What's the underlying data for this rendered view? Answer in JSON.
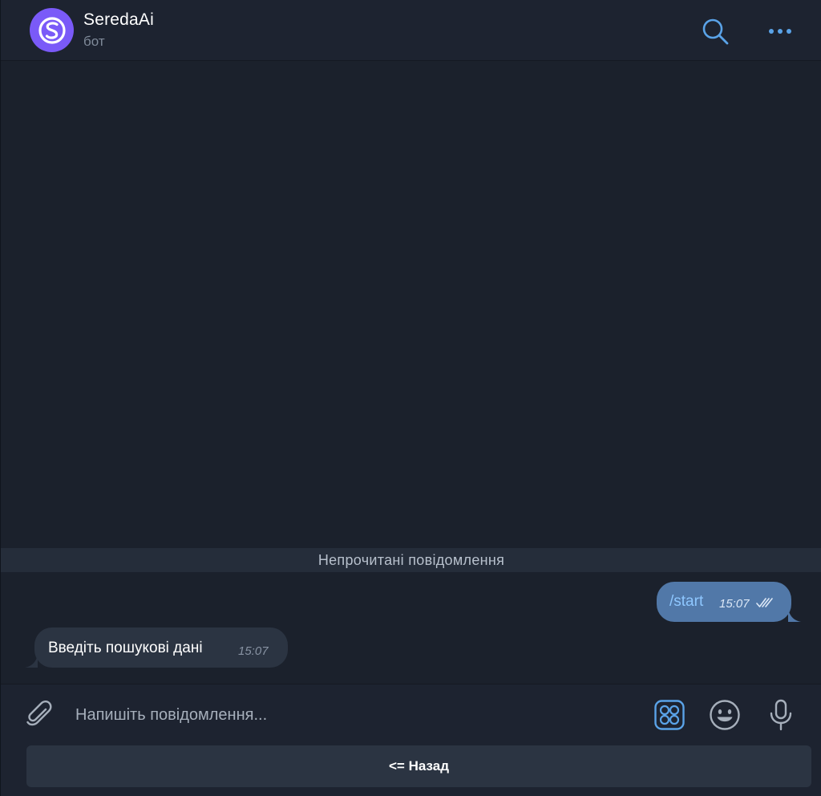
{
  "chat": {
    "title": "SeredaAi",
    "subtitle": "бот",
    "avatar_color": "#7a5af8"
  },
  "header_icons": {
    "search": "search-icon",
    "more": "more-dots-icon"
  },
  "messages": {
    "unread_divider": "Непрочитані повідомлення",
    "items": [
      {
        "direction": "outgoing",
        "text": "/start",
        "time": "15:07",
        "status": "read-double-check"
      },
      {
        "direction": "incoming",
        "text": "Введіть пошукові дані",
        "time": "15:07"
      }
    ]
  },
  "composer": {
    "placeholder": "Напишіть повідомлення...",
    "value": "",
    "icons": [
      "paperclip-icon",
      "bot-menu-icon",
      "emoji-icon",
      "microphone-icon"
    ]
  },
  "reply_keyboard": {
    "buttons": [
      "<= Назад"
    ]
  },
  "colors": {
    "accent": "#5aa3e8",
    "outgoing_bubble": "#5178a8",
    "incoming_bubble": "#2b3442",
    "background": "#1b212c"
  }
}
